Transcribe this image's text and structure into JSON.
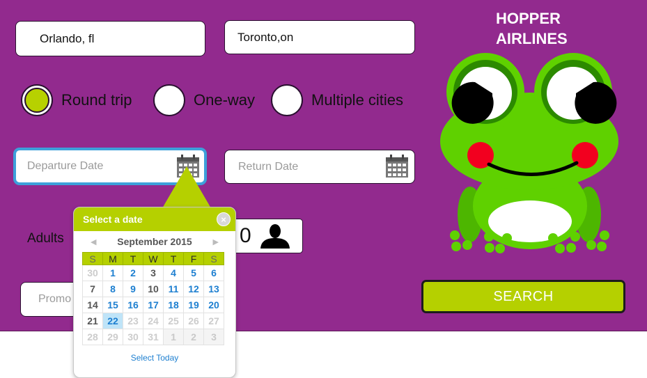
{
  "app": {
    "title_line1": "HOPPER",
    "title_line2": "AIRLINES"
  },
  "trip": {
    "origin": "Orlando, fl",
    "destination": "Toronto,on",
    "options": [
      {
        "label": "Round trip",
        "selected": true
      },
      {
        "label": "One-way",
        "selected": false
      },
      {
        "label": "Multiple cities",
        "selected": false
      }
    ],
    "departure_placeholder": "Departure Date",
    "return_placeholder": "Return Date"
  },
  "passengers": {
    "label": "Adults",
    "count": "0"
  },
  "promo": {
    "placeholder": "Promo"
  },
  "search": {
    "label": "SEARCH"
  },
  "datepicker": {
    "header": "Select a date",
    "close": "×",
    "month": "September 2015",
    "prev": "◀",
    "next": "▶",
    "weekdays": [
      "S",
      "M",
      "T",
      "W",
      "T",
      "F",
      "S"
    ],
    "weeks": [
      [
        "30",
        "1",
        "2",
        "3",
        "4",
        "5",
        "6"
      ],
      [
        "7",
        "8",
        "9",
        "10",
        "11",
        "12",
        "13"
      ],
      [
        "14",
        "15",
        "16",
        "17",
        "18",
        "19",
        "20"
      ],
      [
        "21",
        "22",
        "23",
        "24",
        "25",
        "26",
        "27"
      ],
      [
        "28",
        "29",
        "30",
        "31",
        "1",
        "2",
        "3"
      ]
    ],
    "styles": [
      [
        "dim",
        "blue",
        "blue",
        "gray",
        "blue",
        "blue",
        "blue"
      ],
      [
        "gray",
        "blue",
        "blue",
        "gray",
        "blue",
        "blue",
        "blue"
      ],
      [
        "gray",
        "blue",
        "blue",
        "blue",
        "blue",
        "blue",
        "blue"
      ],
      [
        "gray",
        "sel",
        "dim",
        "dim",
        "dim",
        "dim",
        "dim"
      ],
      [
        "dim",
        "dim",
        "dim",
        "dim",
        "next",
        "next",
        "next"
      ]
    ],
    "select_today": "Select Today"
  },
  "colors": {
    "panel": "#922a8e",
    "accent": "#b5d000",
    "frog": "#5fd100",
    "link": "#1d7fd0"
  }
}
